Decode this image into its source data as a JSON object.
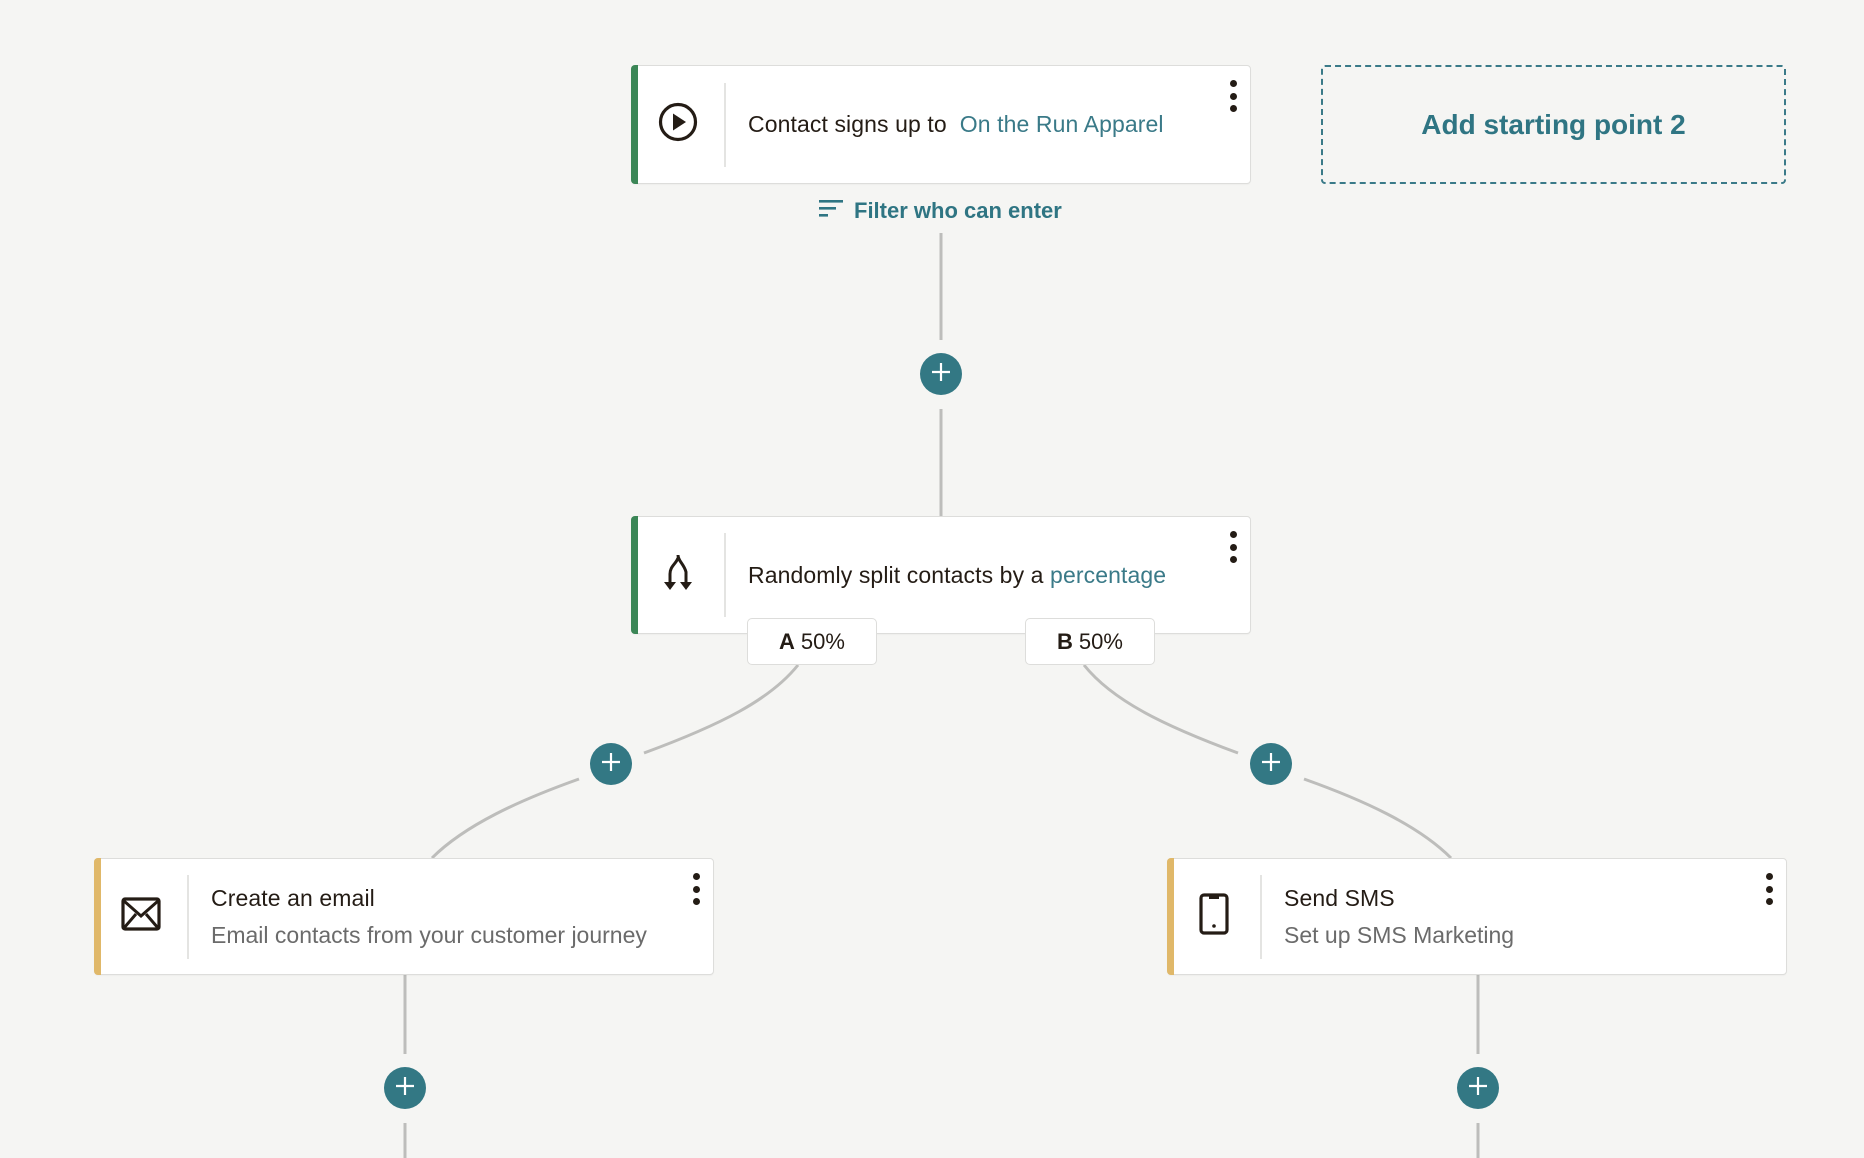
{
  "colors": {
    "background": "#f5f5f3",
    "teal": "#337884",
    "link": "#3a7a88",
    "trigger_accent": "#3b8656",
    "action_accent": "#e0b869",
    "connector": "#bdbdbb"
  },
  "trigger": {
    "icon": "play-circle-icon",
    "prefix": "Contact signs up to",
    "link": "On the Run Apparel",
    "menu_icon": "more-vertical-icon"
  },
  "add_starting_point": {
    "label": "Add starting point 2"
  },
  "filter": {
    "icon": "filter-lines-icon",
    "label": "Filter who can enter"
  },
  "split": {
    "icon": "split-arrows-icon",
    "prefix": "Randomly split contacts by a",
    "link": "percentage",
    "menu_icon": "more-vertical-icon",
    "branches": [
      {
        "letter": "A",
        "percent": "50%"
      },
      {
        "letter": "B",
        "percent": "50%"
      }
    ]
  },
  "actions": [
    {
      "icon": "envelope-icon",
      "title": "Create an email",
      "subtitle": "Email contacts from your customer journey",
      "menu_icon": "more-vertical-icon"
    },
    {
      "icon": "mobile-phone-icon",
      "title": "Send SMS",
      "subtitle": "Set up SMS Marketing",
      "menu_icon": "more-vertical-icon"
    }
  ],
  "add_step_buttons": [
    {
      "icon": "plus-icon",
      "position": "after-trigger"
    },
    {
      "icon": "plus-icon",
      "position": "branch-a"
    },
    {
      "icon": "plus-icon",
      "position": "branch-b"
    },
    {
      "icon": "plus-icon",
      "position": "after-email"
    },
    {
      "icon": "plus-icon",
      "position": "after-sms"
    }
  ]
}
